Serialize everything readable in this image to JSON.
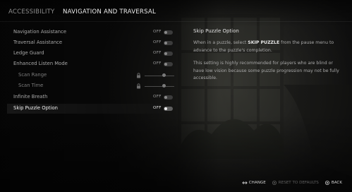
{
  "tabs": [
    {
      "label": "ACCESSIBILITY",
      "active": false
    },
    {
      "label": "NAVIGATION AND TRAVERSAL",
      "active": true
    }
  ],
  "settings": [
    {
      "label": "Navigation Assistance",
      "value": "OFF",
      "control": "toggle",
      "on": false
    },
    {
      "label": "Traversal Assistance",
      "value": "OFF",
      "control": "toggle",
      "on": false
    },
    {
      "label": "Ledge Guard",
      "value": "OFF",
      "control": "toggle",
      "on": false
    },
    {
      "label": "Enhanced Listen Mode",
      "value": "OFF",
      "control": "toggle",
      "on": false
    },
    {
      "label": "Scan Range",
      "control": "slider",
      "locked": true,
      "level": 0.65
    },
    {
      "label": "Scan Time",
      "control": "slider",
      "locked": true,
      "level": 0.65
    },
    {
      "label": "Infinite Breath",
      "value": "OFF",
      "control": "toggle",
      "on": false
    },
    {
      "label": "Skip Puzzle Option",
      "value": "OFF",
      "control": "toggle",
      "on": false,
      "selected": true
    }
  ],
  "info": {
    "title": "Skip Puzzle Option",
    "para1_before": "When in a puzzle, select ",
    "para1_highlight": "SKIP PUZZLE",
    "para1_after": " from the pause menu to advance to the puzzle's completion.",
    "para2": "This setting is highly recommended for players who are blind or have low vision because some puzzle progression may not be fully accessible."
  },
  "footer": {
    "change": {
      "label": "CHANGE",
      "icon": "dpad-left-right-icon"
    },
    "reset": {
      "label": "RESET TO DEFAULTS",
      "icon": "circle-button-icon",
      "enabled": false
    },
    "back": {
      "label": "BACK",
      "icon": "circle-button-icon"
    }
  },
  "colors": {
    "background": "#171717",
    "text_active": "#f2f2f2",
    "text_inactive": "#a8a8a8",
    "text_disabled": "#5f5f5f"
  }
}
